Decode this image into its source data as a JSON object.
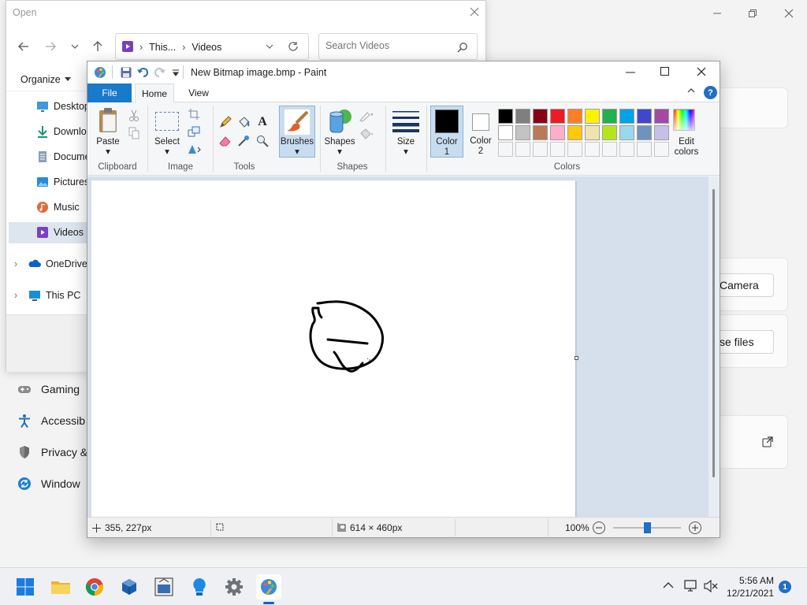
{
  "settings_bg": {
    "nav_items": [
      "Gaming",
      "Accessib",
      "Privacy &",
      "Window"
    ],
    "camera_button": "Camera",
    "files_button": "se files"
  },
  "open_dialog": {
    "title": "Open",
    "breadcrumb": [
      "This...",
      "Videos"
    ],
    "search_placeholder": "Search Videos",
    "organize_label": "Organize",
    "quick_access": [
      "Desktop",
      "Downloa",
      "Docume",
      "Pictures",
      "Music",
      "Videos"
    ],
    "roots": [
      "OneDrive",
      "This PC"
    ]
  },
  "paint": {
    "title": "New Bitmap image.bmp - Paint",
    "tabs": [
      "File",
      "Home",
      "View"
    ],
    "groups": {
      "clipboard": "Clipboard",
      "image": "Image",
      "tools": "Tools",
      "shapes": "Shapes",
      "colors": "Colors"
    },
    "buttons": {
      "paste": "Paste",
      "select": "Select",
      "brushes": "Brushes",
      "shapes": "Shapes",
      "size": "Size",
      "color1": [
        "Color",
        "1"
      ],
      "color2": [
        "Color",
        "2"
      ],
      "edit_colors": [
        "Edit",
        "colors"
      ]
    },
    "palette_row1": [
      "#000000",
      "#7f7f7f",
      "#880015",
      "#ed1c24",
      "#ff7f27",
      "#fff200",
      "#22b14c",
      "#00a2e8",
      "#3f48cc",
      "#a349a4"
    ],
    "palette_row2": [
      "#ffffff",
      "#c3c3c3",
      "#b97a57",
      "#ffaec9",
      "#ffc90e",
      "#efe4b0",
      "#b5e61d",
      "#99d9ea",
      "#7092be",
      "#c8bfe7"
    ],
    "color1": "#000000",
    "color2": "#ffffff",
    "status": {
      "position": "355, 227px",
      "canvas_size": "614 × 460px",
      "zoom": "100%",
      "zoom_level": 0.5
    }
  },
  "taskbar": {
    "apps": [
      "start-icon",
      "file-explorer-icon",
      "chrome-icon",
      "virtualbox-icon",
      "cpu-z-icon",
      "lightbulb-icon",
      "settings-gear-icon",
      "paint-icon"
    ],
    "time": "5:56 AM",
    "date": "12/21/2021",
    "notification_count": "1"
  }
}
